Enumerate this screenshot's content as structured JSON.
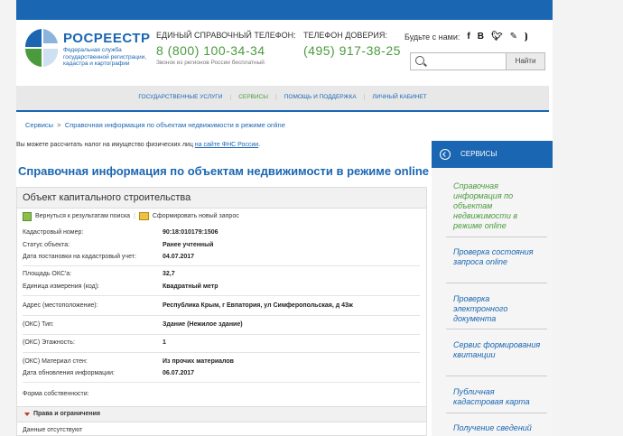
{
  "header": {
    "logo_title": "РОСРЕЕСТР",
    "logo_subtitle": "Федеральная служба государственной регистрации, кадастра и картографии",
    "hotline_label": "ЕДИНЫЙ СПРАВОЧНЫЙ ТЕЛЕФОН:",
    "hotline_number": "8 (800) 100-34-34",
    "hotline_note": "Звонок из регионов России бесплатный",
    "trust_label": "ТЕЛЕФОН ДОВЕРИЯ:",
    "trust_number": "(495) 917-38-25",
    "social_label": "Будьте с нами:",
    "social_icons": [
      "facebook-icon",
      "vk-icon",
      "twitter-icon",
      "livejournal-icon",
      "rss-icon"
    ],
    "search_placeholder": "",
    "search_button": "Найти"
  },
  "nav": {
    "items": [
      "ГОСУДАРСТВЕННЫЕ УСЛУГИ",
      "СЕРВИСЫ",
      "ПОМОЩЬ И ПОДДЕРЖКА",
      "ЛИЧНЫЙ КАБИНЕТ"
    ],
    "active": "СЕРВИСЫ"
  },
  "breadcrumb": {
    "root": "Сервисы",
    "sep": ">",
    "current": "Справочная информация по объектам недвижимости в режиме online"
  },
  "fns_note": {
    "text": "Вы можете рассчитать налог на имущество физических лиц ",
    "link": "на сайте ФНС России",
    "end": "."
  },
  "page_title": "Справочная информация по объектам недвижимости в режиме online",
  "card": {
    "title": "Объект капитального строительства",
    "back_link": "Вернуться к результатам поиска",
    "sep": "|",
    "new_request": "Сформировать новый запрос",
    "fields": [
      {
        "label": "Кадастровый номер:",
        "value": "90:18:010179:1506"
      },
      {
        "label": "Статус объекта:",
        "value": "Ранее учтенный"
      },
      {
        "label": "Дата постановки на кадастровый учет:",
        "value": "04.07.2017"
      },
      {
        "label": "Площадь ОКС'а:",
        "value": "32,7"
      },
      {
        "label": "Единица измерения (код):",
        "value": "Квадратный метр"
      },
      {
        "label": "Адрес (местоположение):",
        "value": "Республика Крым, г Евпатория, ул Симферопольская, д 43ж"
      },
      {
        "label": "(ОКС) Тип:",
        "value": "Здание (Нежилое здание)"
      },
      {
        "label": "(ОКС) Этажность:",
        "value": "1"
      },
      {
        "label": "(ОКС) Материал стен:",
        "value": "Из прочих материалов"
      },
      {
        "label": "Дата обновления информации:",
        "value": "06.07.2017"
      },
      {
        "label": "Форма собственности:",
        "value": ""
      }
    ],
    "rights_section": "Права и ограничения",
    "rights_empty": "Данные отсутствуют"
  },
  "sidebar": {
    "title": "СЕРВИСЫ",
    "items": [
      "Справочная информация по объектам недвижимости в режиме online",
      "Проверка состояния запроса online",
      "Проверка электронного документа",
      "Сервис формирования квитанции",
      "Публичная кадастровая карта",
      "Получение сведений"
    ]
  }
}
